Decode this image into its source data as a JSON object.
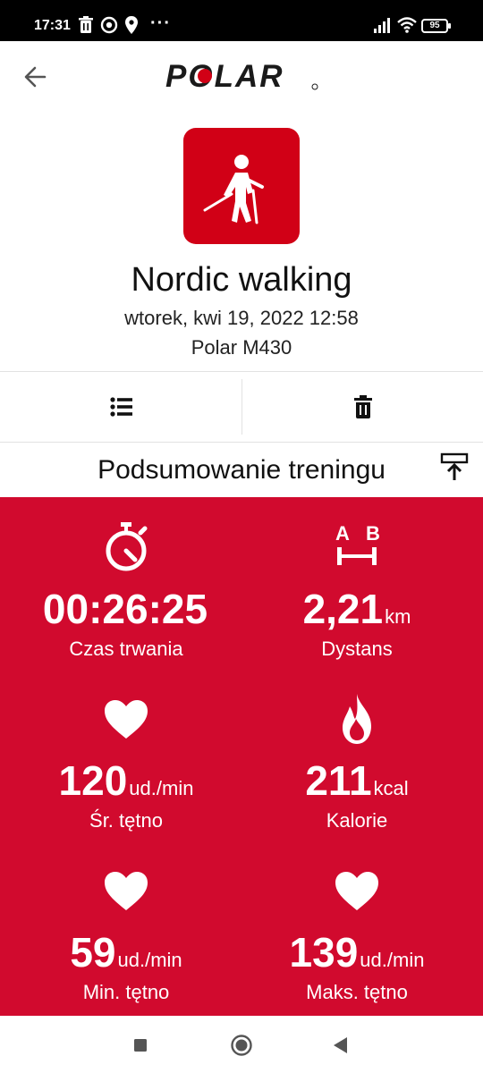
{
  "status_bar": {
    "time": "17:31",
    "more_indicator": "···",
    "battery": "95",
    "left_icons": [
      "trash-icon",
      "chrome-icon",
      "location-icon"
    ],
    "right_icons": [
      "signal-icon",
      "wifi-icon",
      "battery-icon"
    ]
  },
  "header": {
    "logo_text": "POLAR",
    "back_icon": "arrow-left-icon"
  },
  "sport": {
    "icon": "nordic-walking-icon",
    "name": "Nordic walking",
    "date": "wtorek, kwi 19, 2022 12:58",
    "device": "Polar M430"
  },
  "actions": {
    "list_icon": "list-icon",
    "delete_icon": "trash-icon"
  },
  "summary": {
    "title": "Podsumowanie treningu",
    "export_icon": "export-icon",
    "stats": [
      {
        "icon": "stopwatch-icon",
        "value": "00:26:25",
        "unit": "",
        "label": "Czas trwania"
      },
      {
        "icon": "distance-icon",
        "value": "2,21",
        "unit": "km",
        "label": "Dystans"
      },
      {
        "icon": "heart-icon",
        "value": "120",
        "unit": "ud./min",
        "label": "Śr. tętno"
      },
      {
        "icon": "flame-icon",
        "value": "211",
        "unit": "kcal",
        "label": "Kalorie"
      },
      {
        "icon": "heart-icon",
        "value": "59",
        "unit": "ud./min",
        "label": "Min. tętno"
      },
      {
        "icon": "heart-icon",
        "value": "139",
        "unit": "ud./min",
        "label": "Maks. tętno"
      }
    ]
  },
  "colors": {
    "accent_red": "#d10a2e",
    "icon_tile_red": "#d10016",
    "status_bar": "#000000"
  },
  "nav": {
    "recents_icon": "square-icon",
    "home_icon": "circle-icon",
    "back_icon": "triangle-back-icon"
  }
}
